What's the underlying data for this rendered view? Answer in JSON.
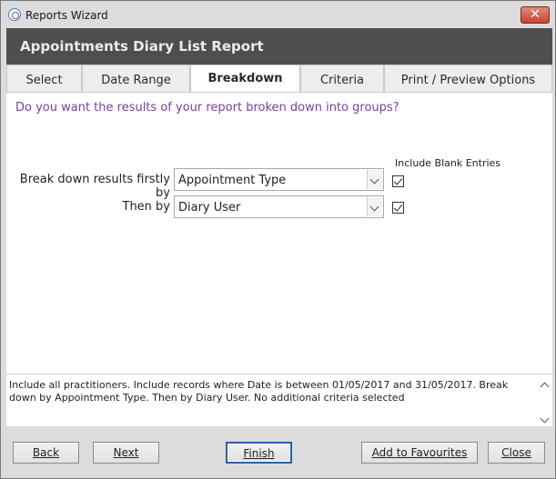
{
  "window": {
    "title": "Reports Wizard",
    "close_glyph": "✕"
  },
  "header": {
    "title": "Appointments Diary List Report"
  },
  "tabs": [
    {
      "label": "Select"
    },
    {
      "label": "Date Range"
    },
    {
      "label": "Breakdown",
      "active": true
    },
    {
      "label": "Criteria"
    },
    {
      "label": "Print / Preview Options"
    }
  ],
  "breakdown": {
    "question": "Do you want the results of your report broken down into groups?",
    "include_blank_label": "Include Blank Entries",
    "rows": [
      {
        "label": "Break down results firstly by",
        "value": "Appointment Type",
        "include_blank": true
      },
      {
        "label": "Then by",
        "value": "Diary User",
        "include_blank": true
      }
    ]
  },
  "summary": {
    "text": "Include all practitioners. Include records where Date is between 01/05/2017 and 31/05/2017. Break down by Appointment Type. Then by Diary User. No additional criteria selected"
  },
  "footer": {
    "back_label": "Back",
    "next_label": "Next",
    "finish_label": "Finish",
    "favourites_label": "Add to Favourites",
    "close_label": "Close"
  },
  "colors": {
    "header_band": "#4e4e4e",
    "question_text": "#7b3fa0",
    "default_button_border": "#2a5fa8"
  },
  "icons": {
    "title": "reports-wizard-icon",
    "close": "close-icon",
    "dropdown": "chevron-down-icon",
    "checkbox": "checkmark-icon"
  }
}
